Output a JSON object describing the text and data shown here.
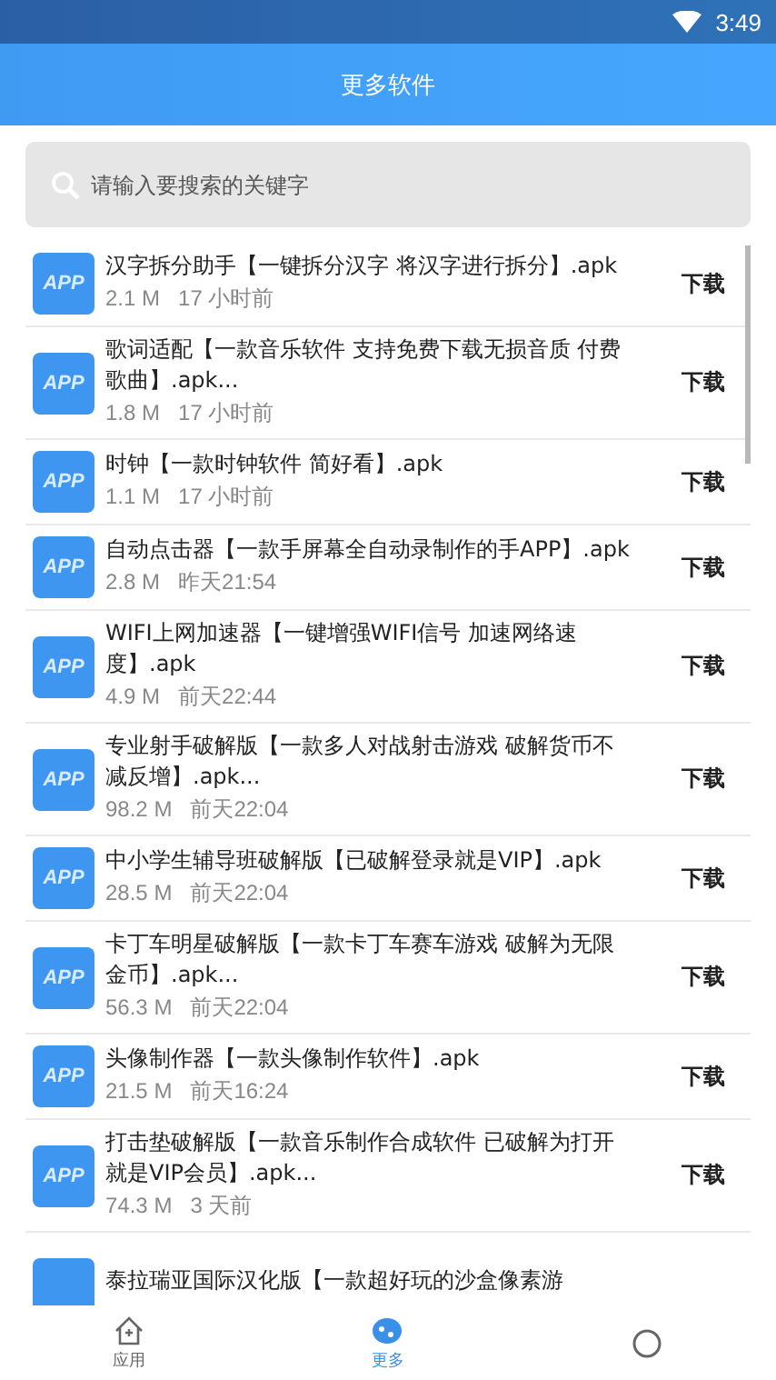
{
  "status_bar": {
    "time": "3:49"
  },
  "header": {
    "title": "更多软件"
  },
  "search": {
    "placeholder": "请输入要搜索的关键字"
  },
  "files": [
    {
      "icon_text": "APP",
      "name": "汉字拆分助手【一键拆分汉字 将汉字进行拆分】.apk",
      "size": "2.1 M",
      "time": "17 小时前",
      "action": "下载"
    },
    {
      "icon_text": "APP",
      "name": "歌词适配【一款音乐软件 支持免费下载无损音质 付费歌曲】.apk...",
      "size": "1.8 M",
      "time": "17 小时前",
      "action": "下载"
    },
    {
      "icon_text": "APP",
      "name": "时钟【一款时钟软件 简好看】.apk",
      "size": "1.1 M",
      "time": "17 小时前",
      "action": "下载"
    },
    {
      "icon_text": "APP",
      "name": "自动点击器【一款手屏幕全自动录制作的手APP】.apk",
      "size": "2.8 M",
      "time": "昨天21:54",
      "action": "下载"
    },
    {
      "icon_text": "APP",
      "name": "WIFI上网加速器【一键增强WIFI信号 加速网络速度】.apk",
      "size": "4.9 M",
      "time": "前天22:44",
      "action": "下载"
    },
    {
      "icon_text": "APP",
      "name": "专业射手破解版【一款多人对战射击游戏 破解货币不减反增】.apk...",
      "size": "98.2 M",
      "time": "前天22:04",
      "action": "下载"
    },
    {
      "icon_text": "APP",
      "name": "中小学生辅导班破解版【已破解登录就是VIP】.apk",
      "size": "28.5 M",
      "time": "前天22:04",
      "action": "下载"
    },
    {
      "icon_text": "APP",
      "name": "卡丁车明星破解版【一款卡丁车赛车游戏 破解为无限金币】.apk...",
      "size": "56.3 M",
      "time": "前天22:04",
      "action": "下载"
    },
    {
      "icon_text": "APP",
      "name": "头像制作器【一款头像制作软件】.apk",
      "size": "21.5 M",
      "time": "前天16:24",
      "action": "下载"
    },
    {
      "icon_text": "APP",
      "name": "打击垫破解版【一款音乐制作合成软件 已破解为打开就是VIP会员】.apk...",
      "size": "74.3 M",
      "time": "3 天前",
      "action": "下载"
    },
    {
      "name": "泰拉瑞亚国际汉化版【一款超好玩的沙盒像素游"
    }
  ],
  "nav": [
    {
      "kind": "home",
      "label": "应用",
      "selected": false
    },
    {
      "kind": "more",
      "label": "更多",
      "selected": true
    },
    {
      "kind": "about",
      "selected": false
    }
  ]
}
